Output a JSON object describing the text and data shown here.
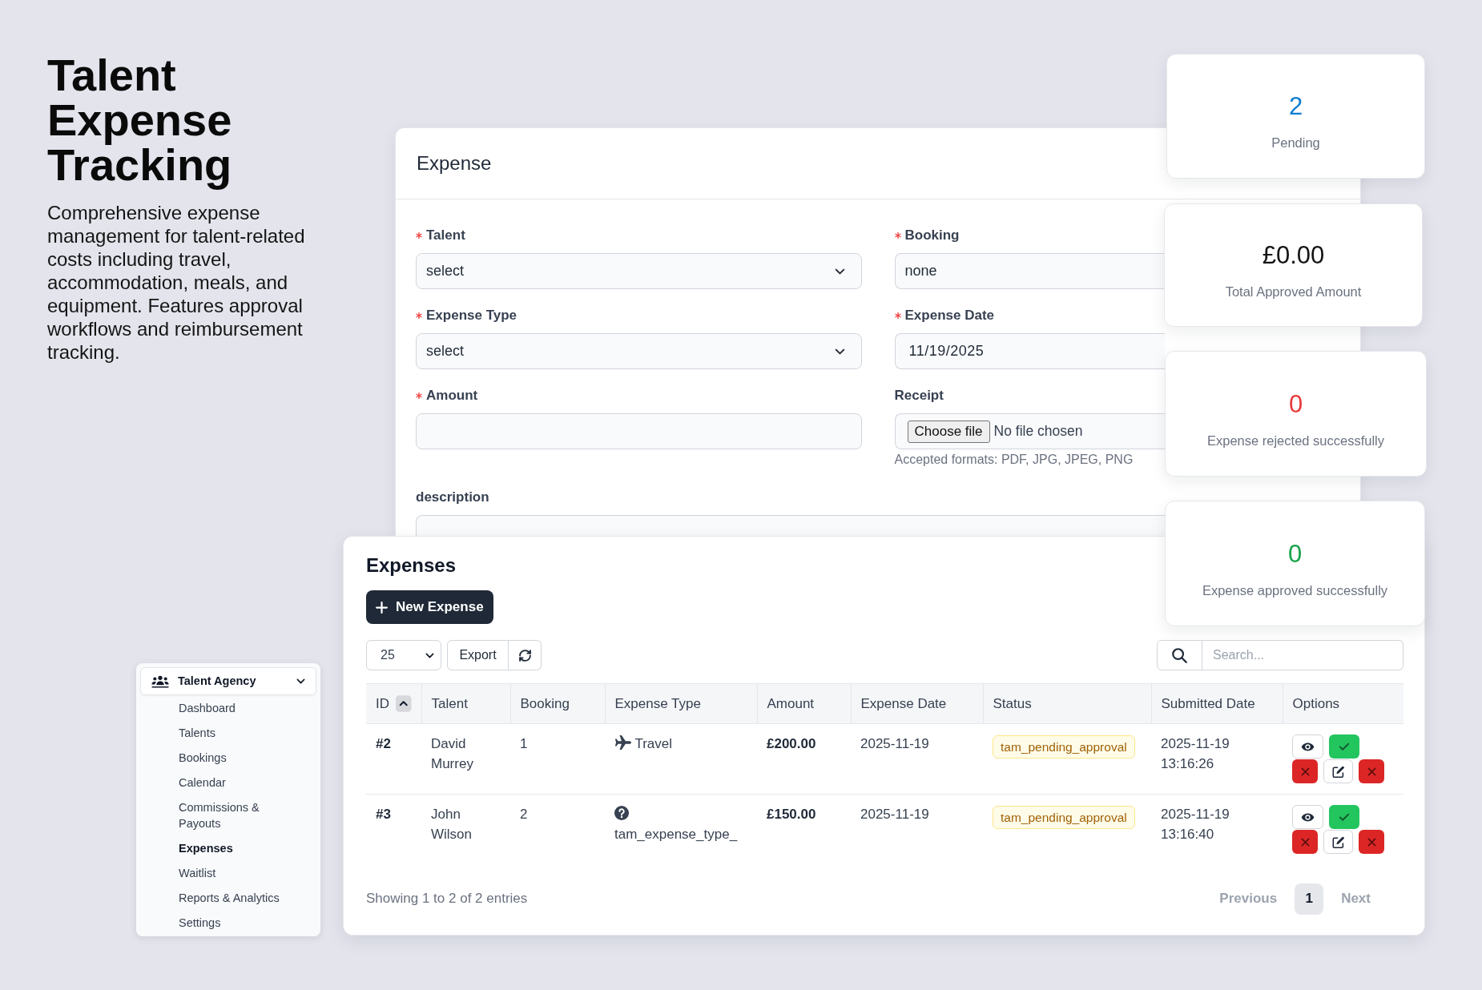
{
  "intro": {
    "title": "Talent Expense Tracking",
    "description": "Comprehensive expense management for talent-related costs including travel, accommodation, meals, and equipment. Features approval workflows and reimbursement tracking."
  },
  "sidebar": {
    "group": {
      "label": "Talent Agency",
      "expanded": true
    },
    "items": [
      {
        "label": "Dashboard",
        "selected": false
      },
      {
        "label": "Talents",
        "selected": false
      },
      {
        "label": "Bookings",
        "selected": false
      },
      {
        "label": "Calendar",
        "selected": false
      },
      {
        "label": "Commissions & Payouts",
        "selected": false
      },
      {
        "label": "Expenses",
        "selected": true
      },
      {
        "label": "Waitlist",
        "selected": false
      },
      {
        "label": "Reports & Analytics",
        "selected": false
      },
      {
        "label": "Settings",
        "selected": false
      }
    ]
  },
  "form": {
    "title": "Expense",
    "fields": [
      {
        "kind": "select",
        "label": "Talent",
        "required": true,
        "value": "select"
      },
      {
        "kind": "text",
        "label": "Booking",
        "required": true,
        "value": "none"
      },
      {
        "kind": "select",
        "label": "Expense Type",
        "required": true,
        "value": "select"
      },
      {
        "kind": "date",
        "label": "Expense Date",
        "required": true,
        "value": "11/19/2025"
      },
      {
        "kind": "text",
        "label": "Amount",
        "required": true
      },
      {
        "kind": "file",
        "label": "Receipt",
        "required": false,
        "button": "Choose file",
        "file_text": "No file chosen",
        "help": "Accepted formats: PDF, JPG, JPEG, PNG"
      },
      {
        "kind": "textarea",
        "label": "description",
        "required": false
      }
    ]
  },
  "stats": [
    {
      "value": "2",
      "label": "Pending",
      "color": "#0b7dd1"
    },
    {
      "value": "£0.00",
      "label": "Total Approved Amount",
      "color": "#141414"
    },
    {
      "value": "0",
      "label": "Expense rejected successfully",
      "color": "#e63b3b"
    },
    {
      "value": "0",
      "label": "Expense approved successfully",
      "color": "#17a34a"
    }
  ],
  "expenses": {
    "title": "Expenses",
    "new_button": "New Expense",
    "page_size": "25",
    "export_button": "Export",
    "search": {
      "placeholder": "Search..."
    },
    "table": {
      "columns": [
        {
          "label": "ID",
          "sorted": true
        },
        {
          "label": "Talent",
          "sorted": false
        },
        {
          "label": "Booking",
          "sorted": false
        },
        {
          "label": "Expense Type",
          "sorted": false
        },
        {
          "label": "Amount",
          "sorted": false
        },
        {
          "label": "Expense Date",
          "sorted": false
        },
        {
          "label": "Status",
          "sorted": false
        },
        {
          "label": "Submitted Date",
          "sorted": false
        },
        {
          "label": "Options",
          "sorted": false
        }
      ],
      "rows": [
        {
          "id": "#2",
          "talent": "David Murrey",
          "booking": "1",
          "expense_type": {
            "kind": "travel",
            "label": "Travel"
          },
          "amount": "£200.00",
          "expense_date": "2025-11-19",
          "status": "tam_pending_approval",
          "submitted": "2025-11-19 13:16:26"
        },
        {
          "id": "#3",
          "talent": "John Wilson",
          "booking": "2",
          "expense_type": {
            "kind": "unknown",
            "label": "tam_expense_type_"
          },
          "amount": "£150.00",
          "expense_date": "2025-11-19",
          "status": "tam_pending_approval",
          "submitted": "2025-11-19 13:16:40"
        }
      ]
    },
    "footer": {
      "summary": "Showing 1 to 2 of 2 entries",
      "pagination": {
        "previous": {
          "label": "Previous",
          "disabled": true
        },
        "pages": [
          {
            "label": "1",
            "selected": true
          }
        ],
        "next": {
          "label": "Next",
          "disabled": true
        }
      }
    }
  }
}
